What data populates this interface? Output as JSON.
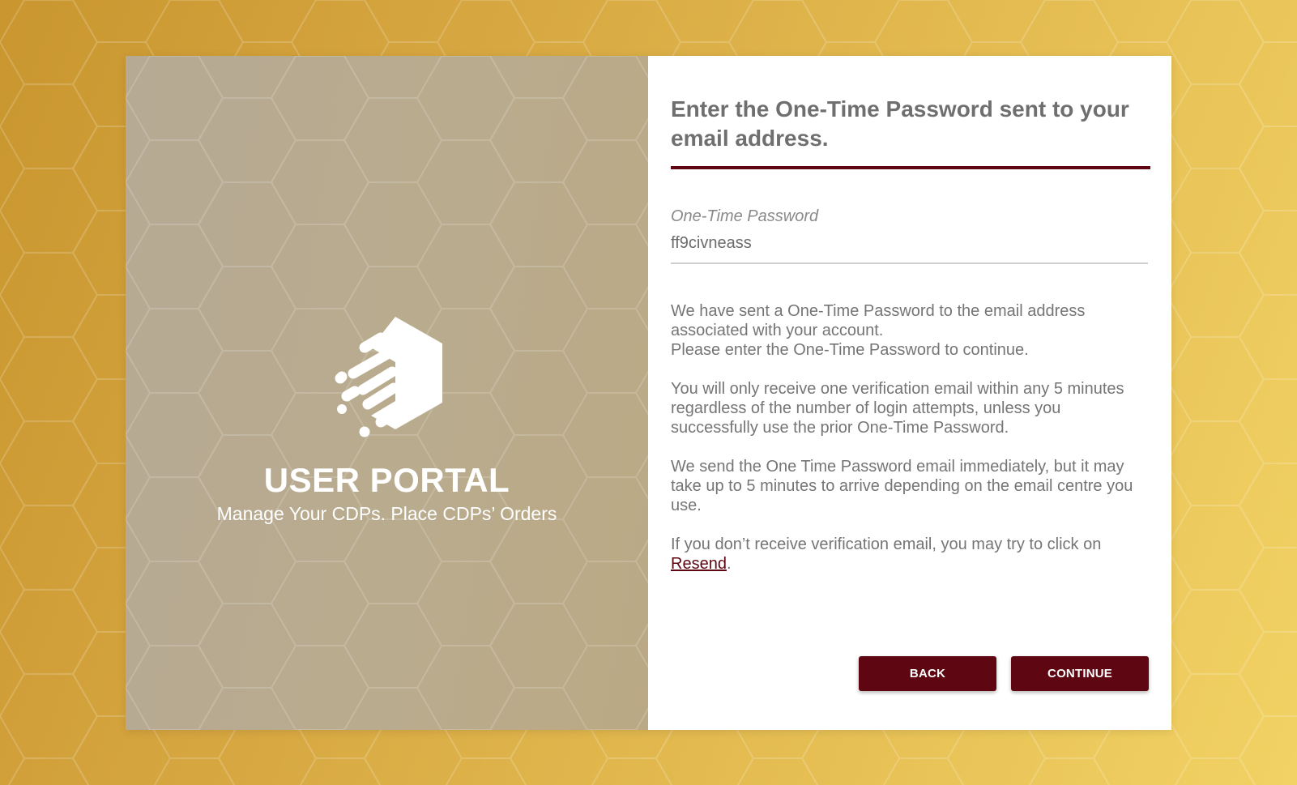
{
  "brand": {
    "title": "USER PORTAL",
    "subtitle": "Manage Your CDPs. Place CDPs’ Orders",
    "logo_icon": "hexagon-cube-speed-logo"
  },
  "otp_form": {
    "heading": "Enter the One-Time Password sent to your email address.",
    "field_label": "One-Time Password",
    "field_value": "ff9civneass",
    "info_paragraph_1_line_1": "We have sent a One-Time Password to the email address associated with your account.",
    "info_paragraph_1_line_2": "Please enter the One-Time Password to continue.",
    "info_paragraph_2": "You will only receive one verification email within any 5 minutes regardless of the number of login attempts, unless you successfully use the prior One-Time Password.",
    "info_paragraph_3": "We send the One Time Password email immediately, but it may take up to 5 minutes to arrive depending on the email centre you use.",
    "info_paragraph_4_prefix": "If you don’t receive verification email, you may try to click on ",
    "resend_label": "Resend",
    "info_paragraph_4_suffix": "."
  },
  "buttons": {
    "back_label": "BACK",
    "continue_label": "CONTINUE"
  },
  "colors": {
    "accent": "#5e0712",
    "background_gold": "#d6a640",
    "left_panel": "#b9ab8d"
  }
}
